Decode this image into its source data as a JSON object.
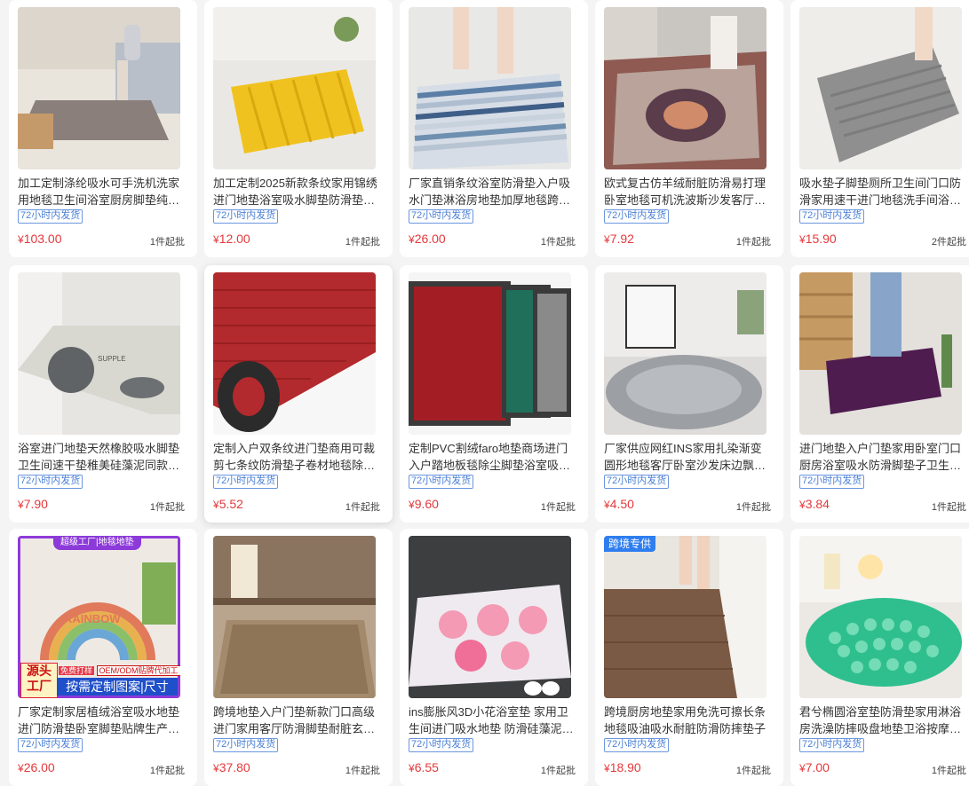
{
  "currency": "¥",
  "products": [
    {
      "title": "加工定制涤纶吸水可手洗机洗家用地毯卫生间浴室厨房脚垫纯…",
      "badge": "72小时内发货",
      "price": "103.00",
      "moq": "1件起批"
    },
    {
      "title": "加工定制2025新款条纹家用锦绣进门地垫浴室吸水脚垫防滑垫…",
      "badge": "72小时内发货",
      "price": "12.00",
      "moq": "1件起批"
    },
    {
      "title": "厂家直销条纹浴室防滑垫入户吸水门垫淋浴房地垫加厚地毯跨…",
      "badge": "72小时内发货",
      "price": "26.00",
      "moq": "1件起批"
    },
    {
      "title": "欧式复古仿羊绒耐脏防滑易打理卧室地毯可机洗波斯沙发客厅…",
      "badge": "72小时内发货",
      "price": "7.92",
      "moq": "1件起批"
    },
    {
      "title": "吸水垫子脚垫厕所卫生间门口防滑家用速干进门地毯洗手间浴…",
      "badge": "72小时内发货",
      "price": "15.90",
      "moq": "2件起批"
    },
    {
      "title": "浴室进门地垫天然橡胶吸水脚垫卫生间速干垫稚美硅藻泥同款…",
      "badge": "72小时内发货",
      "price": "7.90",
      "moq": "1件起批"
    },
    {
      "title": "定制入户双条纹进门垫商用可裁剪七条纹防滑垫子卷材地毯除…",
      "badge": "72小时内发货",
      "price": "5.52",
      "moq": "1件起批"
    },
    {
      "title": "定制PVC割绒faro地垫商场进门入户踏地板毯除尘脚垫浴室吸…",
      "badge": "72小时内发货",
      "price": "9.60",
      "moq": "1件起批"
    },
    {
      "title": "厂家供应网红INS家用扎染渐变圆形地毯客厅卧室沙发床边飘…",
      "badge": "72小时内发货",
      "price": "4.50",
      "moq": "1件起批"
    },
    {
      "title": "进门地垫入户门垫家用卧室门口厨房浴室吸水防滑脚垫子卫生…",
      "badge": "72小时内发货",
      "price": "3.84",
      "moq": "1件起批"
    },
    {
      "title": "厂家定制家居植绒浴室吸水地垫进门防滑垫卧室脚垫贴牌生产…",
      "badge": "72小时内发货",
      "price": "26.00",
      "moq": "1件起批"
    },
    {
      "title": "跨境地垫入户门垫新款门口高级进门家用客厅防滑脚垫耐脏玄…",
      "badge": "72小时内发货",
      "price": "37.80",
      "moq": "1件起批"
    },
    {
      "title": "ins膨胀风3D小花浴室垫 家用卫生间进门吸水地垫 防滑硅藻泥…",
      "badge": "72小时内发货",
      "price": "6.55",
      "moq": "1件起批"
    },
    {
      "title": "跨境厨房地垫家用免洗可擦长条地毯吸油吸水耐脏防滑防摔垫子",
      "badge": "72小时内发货",
      "price": "18.90",
      "moq": "1件起批"
    },
    {
      "title": "君兮椭圆浴室垫防滑垫家用淋浴房洗澡防摔吸盘地垫卫浴按摩…",
      "badge": "72小时内发货",
      "price": "7.00",
      "moq": "1件起批"
    }
  ],
  "overlays": {
    "p11_banner": "超级工厂|地毯地垫",
    "p11_left_top": "源头",
    "p11_left_bottom": "工厂",
    "p11_chip_free": "免费打样",
    "p11_chip_oem": "OEM/ODM贴牌代加工",
    "p11_custom": "按需定制图案|尺寸",
    "p11_rainbow": "RAINBOW",
    "p6_brand": "SUPPLE",
    "p14_tag": "跨境专供"
  }
}
